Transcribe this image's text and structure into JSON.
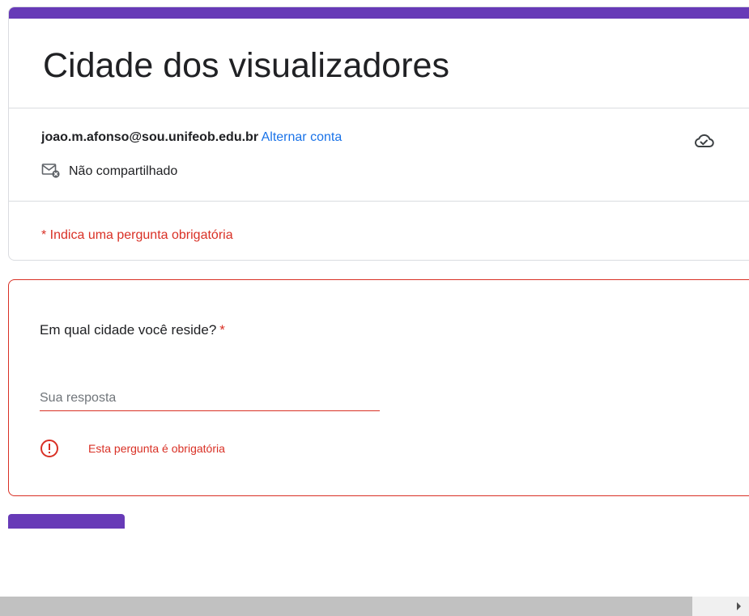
{
  "form": {
    "title": "Cidade dos visualizadores",
    "accent_color": "#673ab7"
  },
  "account": {
    "email": "joao.m.afonso@sou.unifeob.edu.br",
    "switch_label": "Alternar conta",
    "sync_icon": "cloud-check-icon"
  },
  "sharing": {
    "label": "Não compartilhado",
    "icon": "mail-blocked-icon"
  },
  "required_note": "* Indica uma pergunta obrigatória",
  "question": {
    "text": "Em qual cidade você reside?",
    "required_mark": "*",
    "answer_placeholder": "Sua resposta",
    "answer_value": "",
    "error_text": "Esta pergunta é obrigatória",
    "error_icon": "error-circle-icon",
    "error_color": "#d93025"
  },
  "submit": {
    "label": ""
  },
  "scrollbar": {
    "arrow_icon": "arrow-right-icon"
  }
}
